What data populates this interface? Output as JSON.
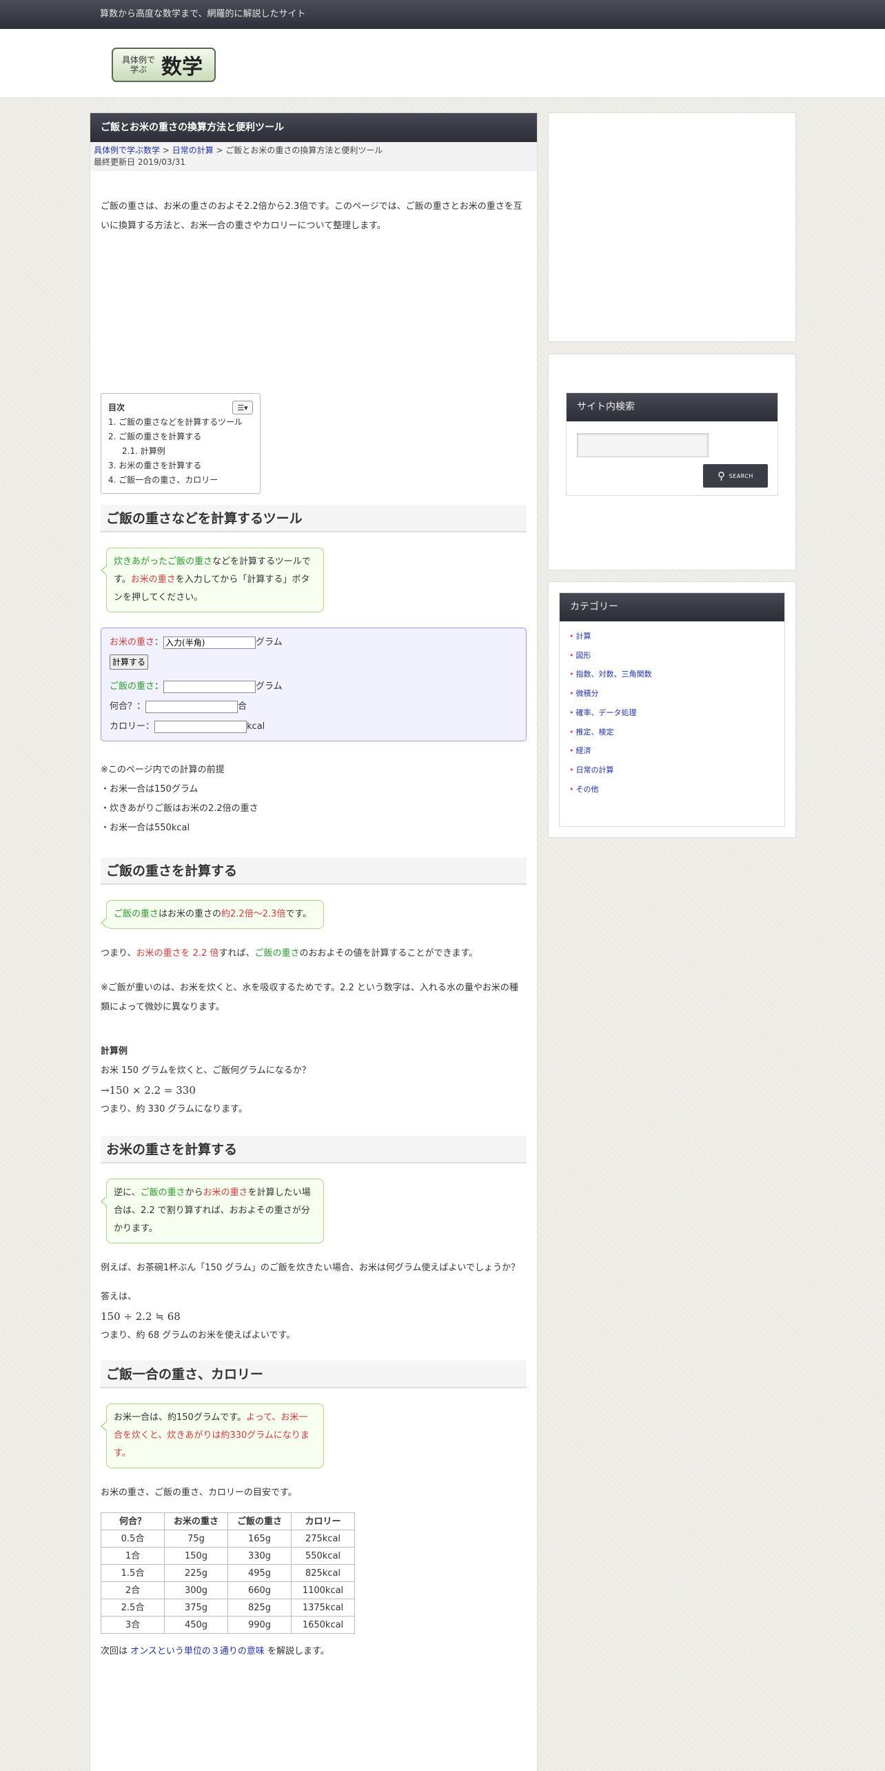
{
  "topbar": {
    "tagline": "算数から高度な数学まで、網羅的に解説したサイト"
  },
  "logo": {
    "small_line1": "具体例で",
    "small_line2": "学ぶ",
    "big": "数学"
  },
  "article": {
    "title": "ご飯とお米の重さの換算方法と便利ツール",
    "breadcrumb": {
      "home": "具体例で学ぶ数学",
      "sep1": " > ",
      "category": "日常の計算",
      "sep2": " > ",
      "current": "ご飯とお米の重さの換算方法と便利ツール"
    },
    "updated": "最終更新日 2019/03/31",
    "intro": "ご飯の重さは、お米の重さのおよそ2.2倍から2.3倍です。このページでは、ご飯の重さとお米の重さを互いに換算する方法と、お米一合の重さやカロリーについて整理します。",
    "toc": {
      "title": "目次",
      "toggle_icon": "☰▾",
      "items": [
        "1. ご飯の重さなどを計算するツール",
        "2. ご飯の重さを計算する",
        "2.1. 計算例",
        "3. お米の重さを計算する",
        "4. ご飯一合の重さ、カロリー"
      ]
    },
    "s1": {
      "heading": "ご飯の重さなどを計算するツール",
      "bubble": {
        "a": "炊きあがったご飯の重さ",
        "b": "などを計算するツールです。",
        "c": "お米の重さ",
        "d": "を入力してから「計算する」ボタンを押してください。"
      },
      "form": {
        "rice_label": "お米の重さ",
        "colon": "：",
        "rice_value": "入力(半角)",
        "unit_gram": "グラム",
        "calc_button": "計算する",
        "cooked_label": "ご飯の重さ",
        "go_label": "何合？：",
        "go_unit": "合",
        "cal_label": "カロリー：",
        "cal_unit": "kcal"
      },
      "notes": [
        "※このページ内での計算の前提",
        "・お米一合は150グラム",
        "・炊きあがりご飯はお米の2.2倍の重さ",
        "・お米一合は550kcal"
      ]
    },
    "s2": {
      "heading": "ご飯の重さを計算する",
      "bubble": {
        "a": "ご飯の重さ",
        "b": "はお米の重さの",
        "c": "約2.2倍～2.3倍",
        "d": "です。"
      },
      "p1": {
        "a": "つまり、",
        "b": "お米の重さを 2.2 倍",
        "c": "すれば、",
        "d": "ご飯の重さ",
        "e": "のおおよその値を計算することができます。"
      },
      "p2": "※ご飯が重いのは、お米を炊くと、水を吸収するためです。2.2 という数字は、入れる水の量やお米の種類によって微妙に異なります。",
      "example_heading": "計算例",
      "ex1": "お米 150 グラムを炊くと、ご飯何グラムになるか？",
      "ex2": "→150 × 2.2 = 330",
      "ex3": "つまり、約 330 グラムになります。"
    },
    "s3": {
      "heading": "お米の重さを計算する",
      "bubble": {
        "a": "逆に、",
        "b": "ご飯の重さ",
        "c": "から",
        "d": "お米の重さ",
        "e": "を計算したい場合は、2.2 で割り算すれば、おおよその重さが分かります。"
      },
      "p1": "例えば、お茶碗1杯ぶん「150 グラム」のご飯を炊きたい場合、お米は何グラム使えばよいでしょうか？",
      "ans": "答えは、",
      "formula": "150 ÷ 2.2 ≒ 68",
      "ans2": "つまり、約 68 グラムのお米を使えばよいです。"
    },
    "s4": {
      "heading": "ご飯一合の重さ、カロリー",
      "bubble": {
        "a": "お米一合は、約150グラムです。",
        "b": "よって、お米一合を炊くと、炊きあがりは約330グラムになります。"
      },
      "p1": "お米の重さ、ご飯の重さ、カロリーの目安です。",
      "table": {
        "headers": [
          "何合？",
          "お米の重さ",
          "ご飯の重さ",
          "カロリー"
        ],
        "rows": [
          [
            "0.5合",
            "75g",
            "165g",
            "275kcal"
          ],
          [
            "1合",
            "150g",
            "330g",
            "550kcal"
          ],
          [
            "1.5合",
            "225g",
            "495g",
            "825kcal"
          ],
          [
            "2合",
            "300g",
            "660g",
            "1100kcal"
          ],
          [
            "2.5合",
            "375g",
            "825g",
            "1375kcal"
          ],
          [
            "3合",
            "450g",
            "990g",
            "1650kcal"
          ]
        ]
      },
      "next": {
        "a": "次回は ",
        "link": "オンスという単位の３通りの意味",
        "b": " を解説します。"
      }
    }
  },
  "sidebar": {
    "search": {
      "heading": "サイト内検索",
      "button": "SEARCH",
      "icon": "search-icon"
    },
    "categories": {
      "heading": "カテゴリー",
      "items": [
        "計算",
        "図形",
        "指数、対数、三角関数",
        "微積分",
        "確率、データ処理",
        "推定、検定",
        "経済",
        "日常の計算",
        "その他"
      ]
    }
  }
}
